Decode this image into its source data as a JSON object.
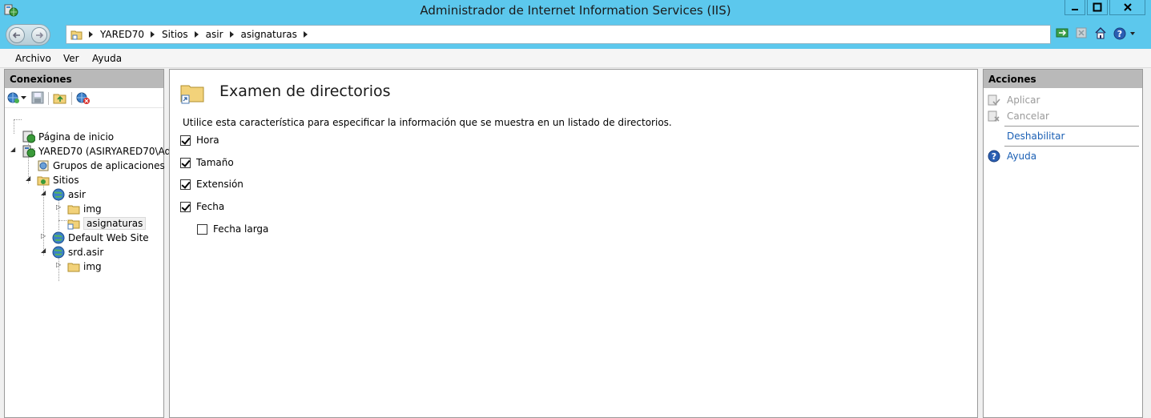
{
  "window": {
    "title": "Administrador de Internet Information Services (IIS)"
  },
  "address": {
    "crumbs": [
      "YARED70",
      "Sitios",
      "asir",
      "asignaturas"
    ]
  },
  "menu": {
    "items": [
      "Archivo",
      "Ver",
      "Ayuda"
    ]
  },
  "connections": {
    "header": "Conexiones",
    "tree": {
      "start_page": "Página de inicio",
      "server": "YARED70 (ASIRYARED70\\Adm",
      "app_pools": "Grupos de aplicaciones",
      "sites": "Sitios",
      "site_asir": "asir",
      "asir_img": "img",
      "asir_asignaturas": "asignaturas",
      "default_site": "Default Web Site",
      "site_srd": "srd.asir",
      "srd_img": "img"
    }
  },
  "feature": {
    "title": "Examen de directorios",
    "description": "Utilice esta característica para especificar la información que se muestra en un listado de directorios.",
    "options": [
      {
        "label": "Hora",
        "checked": true
      },
      {
        "label": "Tamaño",
        "checked": true
      },
      {
        "label": "Extensión",
        "checked": true
      },
      {
        "label": "Fecha",
        "checked": true
      },
      {
        "label": "Fecha larga",
        "checked": false
      }
    ]
  },
  "actions": {
    "header": "Acciones",
    "apply": "Aplicar",
    "cancel": "Cancelar",
    "disable": "Deshabilitar",
    "help": "Ayuda"
  },
  "colors": {
    "titlebar": "#5cc8ed",
    "link": "#1a5fb4",
    "disabled": "#9a9a9a",
    "panel_header": "#b9b9b9"
  }
}
